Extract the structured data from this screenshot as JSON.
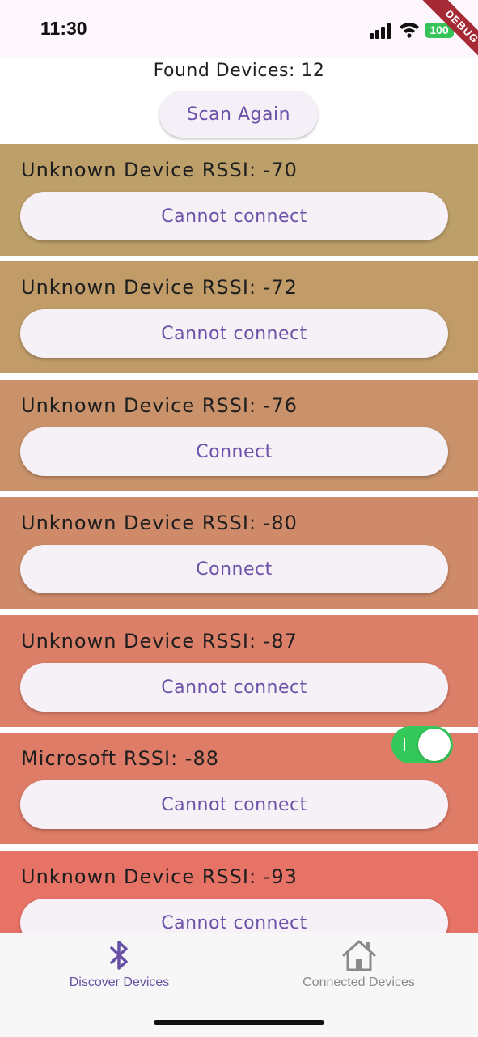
{
  "status_bar": {
    "time": "11:30",
    "battery": "100"
  },
  "debug_banner": "DEBUG",
  "header": {
    "found_text": "Found Devices: 12",
    "scan_button": "Scan Again"
  },
  "devices": [
    {
      "title": "Unknown Device RSSI: -70",
      "button": "Cannot connect",
      "color": "#bd9f69"
    },
    {
      "title": "Unknown Device RSSI: -72",
      "button": "Cannot connect",
      "color": "#c19c69"
    },
    {
      "title": "Unknown Device RSSI: -76",
      "button": "Connect",
      "color": "#c9926a"
    },
    {
      "title": "Unknown Device RSSI: -80",
      "button": "Connect",
      "color": "#cf8b69"
    },
    {
      "title": "Unknown Device RSSI: -87",
      "button": "Cannot connect",
      "color": "#dc7f68"
    },
    {
      "title": "Microsoft RSSI: -88",
      "button": "Cannot connect",
      "color": "#df7c67"
    },
    {
      "title": "Unknown Device RSSI: -93",
      "button": "Cannot connect",
      "color": "#e77266"
    }
  ],
  "toggle": {
    "on": true,
    "color": "#34c759"
  },
  "bottom_nav": {
    "items": [
      {
        "label": "Discover Devices",
        "icon": "bluetooth-icon",
        "active": true,
        "color": "#6750a4"
      },
      {
        "label": "Connected Devices",
        "icon": "home-icon",
        "active": false,
        "color": "#8a8a8a"
      }
    ]
  }
}
